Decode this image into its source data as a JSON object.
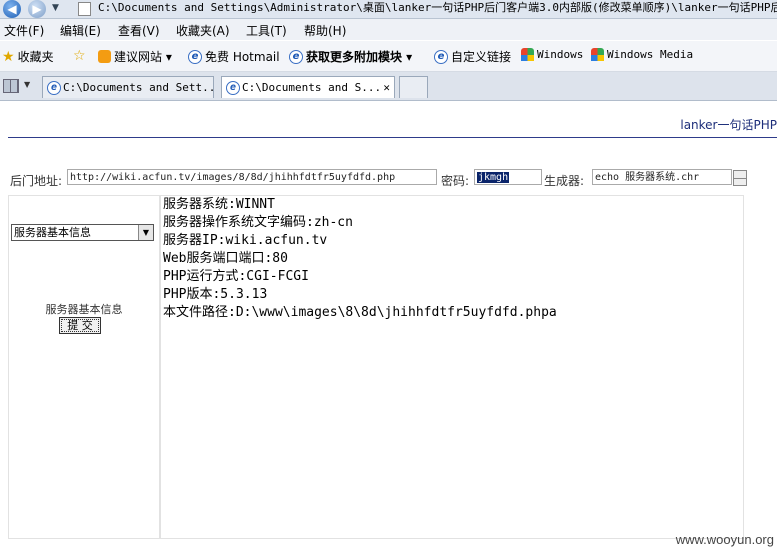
{
  "window": {
    "address": "C:\\Documents and Settings\\Administrator\\桌面\\lanker一句话PHP后门客户端3.0内部版(修改菜单顺序)\\lanker一句话PHP后门..."
  },
  "menu": [
    "文件(F)",
    "编辑(E)",
    "查看(V)",
    "收藏夹(A)",
    "工具(T)",
    "帮助(H)"
  ],
  "favorites": {
    "label": "收藏夹",
    "items": [
      "建议网站 ▾",
      "免费 Hotmail",
      "获取更多附加模块 ▾",
      "自定义链接",
      "Windows",
      "Windows Media"
    ]
  },
  "tabs": [
    {
      "label": "C:\\Documents and Sett..."
    },
    {
      "label": "C:\\Documents and S..."
    }
  ],
  "page": {
    "brand": "lanker一句话PHP",
    "backdoor_label": "后门地址:",
    "backdoor_value": "http://wiki.acfun.tv/images/8/8d/jhihhfdtfr5uyfdfd.php",
    "password_label": "密码:",
    "password_value": "jkmgh",
    "generator_label": "生成器:",
    "generator_value": "echo 服务器系统.chr",
    "dropdown_value": "服务器基本信息",
    "panel_title": "服务器基本信息",
    "submit_label": "提 交",
    "info_lines": [
      "服务器系统:WINNT",
      "服务器操作系统文字编码:zh-cn",
      "服务器IP:wiki.acfun.tv",
      "Web服务端口端口:80",
      "PHP运行方式:CGI-FCGI",
      "PHP版本:5.3.13",
      "本文件路径:D:\\www\\images\\8\\8d\\jhihhfdtfr5uyfdfd.phpa"
    ]
  },
  "watermark": "www.wooyun.org"
}
